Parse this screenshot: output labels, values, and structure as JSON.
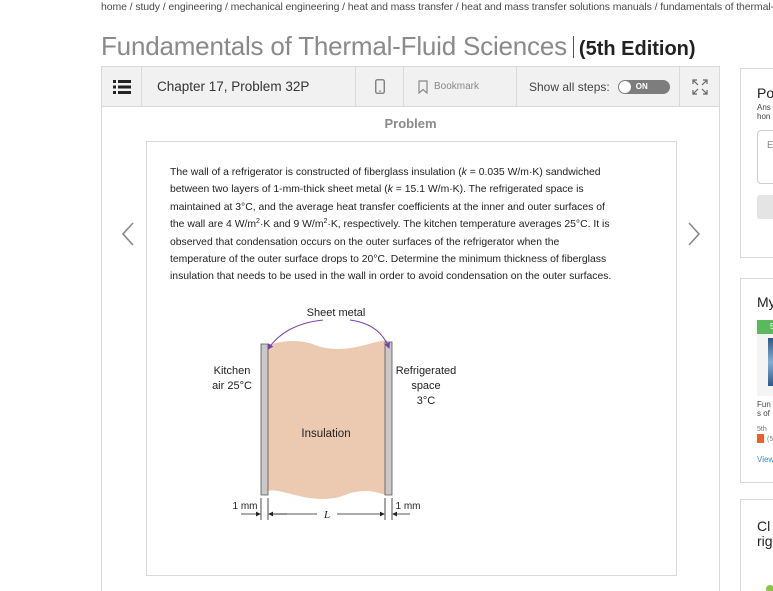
{
  "breadcrumb": "home / study / engineering / mechanical engineering / heat and mass transfer / heat and mass transfer solutions manuals / fundamentals of thermal-fluid sciences",
  "book": {
    "title": "Fundamentals of Thermal-Fluid Sciences",
    "edition": "(5th Edition)"
  },
  "toolbar": {
    "chapter": "Chapter 17, Problem 32P",
    "bookmark_label": "Bookmark",
    "show_steps_label": "Show all steps:",
    "toggle_state": "ON"
  },
  "problem": {
    "heading": "Problem",
    "lines": [
      "The wall of a refrigerator is constructed of fiberglass insulation (k = 0.035 W/m·K) sandwiched",
      "between two layers of 1-mm-thick sheet metal (k = 15.1 W/m·K). The refrigerated space is",
      "maintained at 3°C, and the average heat transfer coefficients at the inner and outer surfaces of",
      "the wall are 4 W/m2·K and 9 W/m2·K, respectively. The kitchen temperature averages 25°C. It is",
      "observed that condensation occurs on the outer surfaces of the refrigerator when the",
      "temperature of the outer surface drops to 20°C. Determine the minimum thickness of fiberglass",
      "insulation that needs to be used in the wall in order to avoid condensation on the outer surfaces."
    ]
  },
  "figure": {
    "sheet_metal": "Sheet metal",
    "kitchen_line1": "Kitchen",
    "kitchen_line2": "air 25°C",
    "fridge_line1": "Refrigerated",
    "fridge_line2": "space",
    "fridge_line3": "3°C",
    "insulation": "Insulation",
    "left_mm": "1 mm",
    "right_mm": "1 mm",
    "L": "L"
  },
  "sidebar": {
    "card1_title": "Po",
    "card1_line1": "Ans",
    "card1_line2": "hon",
    "card1_input": "E",
    "card2_title": "My",
    "card2_badge": "5",
    "card2_book1": "Fun",
    "card2_book2": "s of",
    "card2_edition": "5th",
    "card2_flag": "(5",
    "card2_view": "View",
    "card3_title1": "Cl",
    "card3_title2": "rig"
  },
  "colors": {
    "insulation_fill": "#ecc9b1",
    "sheet_metal_fill": "#c9c9c9",
    "arrow_color": "#7a3fa6",
    "accent_green": "#5cb85c",
    "toggle_bg": "#7d7d7d",
    "title_gray": "#8a8a8a"
  },
  "icons": {
    "toc": "list-icon",
    "mobile": "mobile-phone-icon",
    "bookmark": "bookmark-icon",
    "expand": "expand-icon",
    "prev": "chevron-left-icon",
    "next": "chevron-right-icon"
  }
}
